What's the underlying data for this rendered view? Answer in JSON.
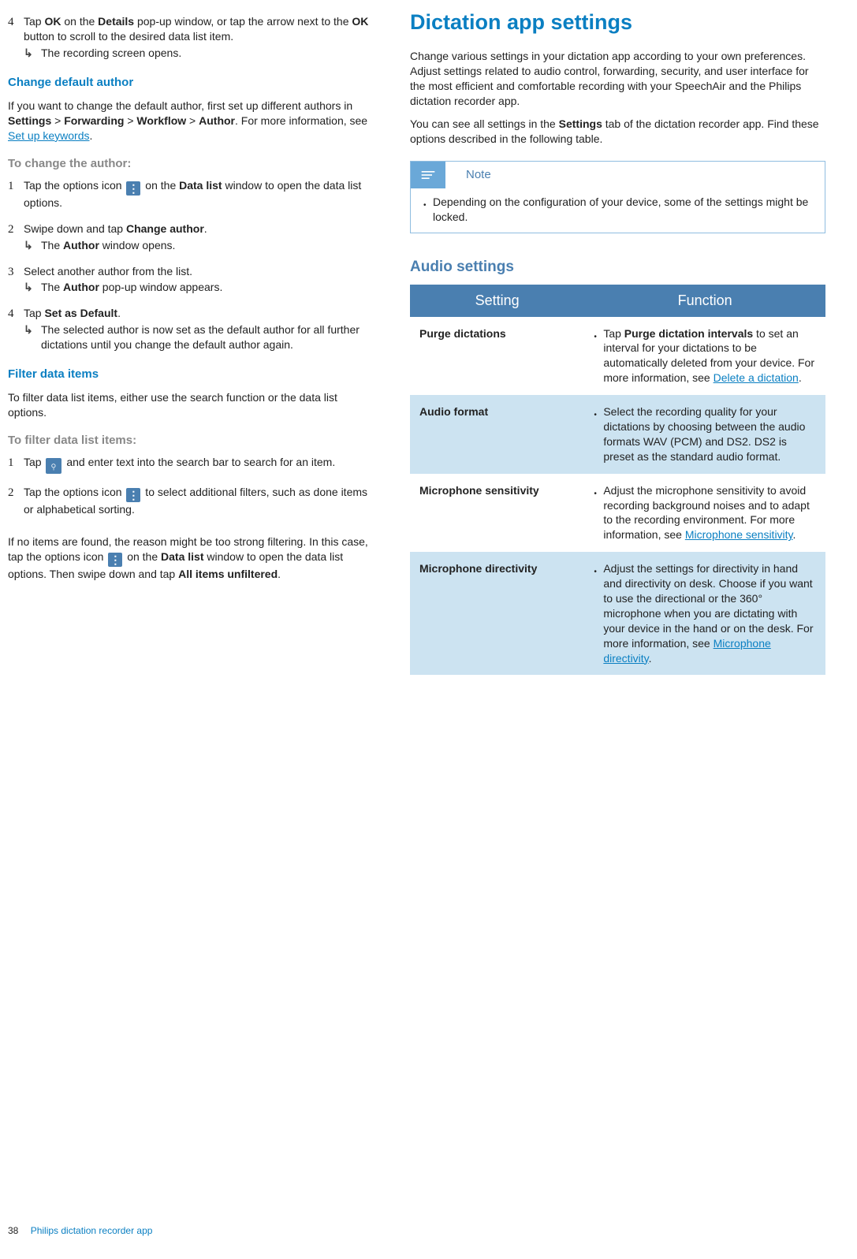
{
  "left": {
    "step4": {
      "num": "4",
      "text_a": "Tap ",
      "bold1": "OK",
      "text_b": " on the ",
      "bold2": "Details",
      "text_c": " pop-up window, or tap the arrow next to the ",
      "bold3": "OK",
      "text_d": " button to scroll to the desired data list item.",
      "result": "The recording screen opens."
    },
    "h_author": "Change default author",
    "author_intro_a": "If you want to change the default author, first set up different authors in ",
    "author_b1": "Settings",
    "gt1": " > ",
    "author_b2": "Forwarding",
    "gt2": " > ",
    "author_b3": "Workflow",
    "gt3": " > ",
    "author_b4": "Author",
    "author_intro_b": ". For more information, see ",
    "author_link": "Set up keywords",
    "author_intro_c": ".",
    "lead_author": "To change the author:",
    "a1": {
      "num": "1",
      "a": "Tap the options icon ",
      "b": " on the ",
      "bold": "Data list",
      "c": " window to open the data list options."
    },
    "a2": {
      "num": "2",
      "a": "Swipe down and tap ",
      "bold": "Change author",
      "b": ".",
      "res_a": "The ",
      "res_bold": "Author",
      "res_b": " window opens."
    },
    "a3": {
      "num": "3",
      "a": "Select another author from the list.",
      "res_a": "The ",
      "res_bold": "Author",
      "res_b": " pop-up window appears."
    },
    "a4": {
      "num": "4",
      "a": "Tap ",
      "bold": "Set as Default",
      "b": ".",
      "res": "The selected author is now set as the default author for all further dictations until you change the default author again."
    },
    "h_filter": "Filter data items",
    "filter_intro": "To filter data list items, either use the search function or the data list options.",
    "lead_filter": "To filter data list items:",
    "f1": {
      "num": "1",
      "a": "Tap ",
      "b": " and enter text into the search bar to search for an item."
    },
    "f2": {
      "num": "2",
      "a": "Tap the options icon ",
      "b": " to select additional filters, such as done items or alphabetical sorting."
    },
    "filter_outro_a": "If no items are found, the reason might be too strong filtering. In this case, tap the options icon ",
    "filter_outro_b": " on the ",
    "filter_outro_bold1": "Data list",
    "filter_outro_c": " window to open the data list options. Then swipe down and tap ",
    "filter_outro_bold2": "All items unfiltered",
    "filter_outro_d": "."
  },
  "right": {
    "h1": "Dictation app settings",
    "p1": "Change various settings in your dictation app according to your own preferences. Adjust settings related to audio control, forwarding, security, and user interface for the most efficient and comfortable recording with your SpeechAir and the Philips dictation recorder app.",
    "p2_a": "You can see all settings in the ",
    "p2_bold": "Settings",
    "p2_b": " tab of the dictation recorder app. Find these options described in the following table.",
    "note_label": "Note",
    "note_body": "Depending on the configuration of your device, some of the settings might be locked.",
    "h2": "Audio settings",
    "th1": "Setting",
    "th2": "Function",
    "rows": [
      {
        "name": "Purge dictations",
        "func_a": "Tap ",
        "func_bold": "Purge dictation intervals",
        "func_b": " to set an interval for your dictations to be automatically deleted from your device. For more information, see ",
        "link": "Delete a dictation",
        "func_c": "."
      },
      {
        "name": "Audio format",
        "func": "Select the recording quality for your dictations by choosing between the audio formats WAV (PCM) and DS2. DS2 is preset as the standard audio format."
      },
      {
        "name": "Microphone sensitivity",
        "func_a": "Adjust the microphone sensitivity to avoid recording background noises and to adapt to the recording environment. For more information, see ",
        "link": "Microphone sensitivity",
        "func_c": "."
      },
      {
        "name": "Microphone directivity",
        "func_a": "Adjust the settings for directivity in hand and directivity on desk. Choose if you want to use the directional or the 360° microphone when you are dictating with your device in the hand or on the desk. For more information, see ",
        "link": "Microphone directivity",
        "func_c": "."
      }
    ]
  },
  "footer": {
    "page": "38",
    "chapter": "Philips dictation recorder app"
  }
}
